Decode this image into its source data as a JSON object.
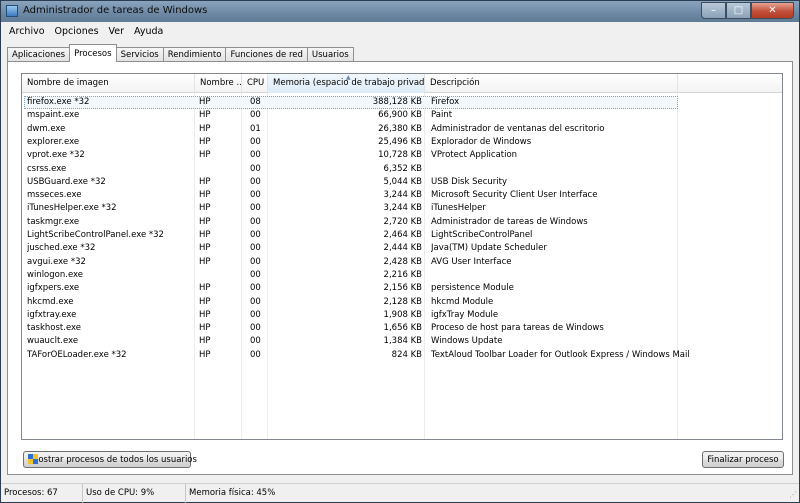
{
  "window": {
    "title": "Administrador de tareas de Windows",
    "caption_buttons": {
      "minimize": "–",
      "maximize": "□",
      "close": "✕"
    }
  },
  "menu": [
    "Archivo",
    "Opciones",
    "Ver",
    "Ayuda"
  ],
  "tabs": [
    {
      "label": "Aplicaciones",
      "active": false
    },
    {
      "label": "Procesos",
      "active": true
    },
    {
      "label": "Servicios",
      "active": false
    },
    {
      "label": "Rendimiento",
      "active": false
    },
    {
      "label": "Funciones de red",
      "active": false
    },
    {
      "label": "Usuarios",
      "active": false
    }
  ],
  "columns": {
    "name": "Nombre de imagen",
    "user": "Nombre ...",
    "cpu": "CPU",
    "mem": "Memoria (espacio de trabajo privado)",
    "desc": "Descripción"
  },
  "processes": [
    {
      "name": "firefox.exe *32",
      "user": "HP",
      "cpu": "08",
      "mem": "388,128 KB",
      "desc": "Firefox",
      "selected": true
    },
    {
      "name": "mspaint.exe",
      "user": "HP",
      "cpu": "00",
      "mem": "66,900 KB",
      "desc": "Paint"
    },
    {
      "name": "dwm.exe",
      "user": "HP",
      "cpu": "01",
      "mem": "26,380 KB",
      "desc": "Administrador de ventanas del escritorio"
    },
    {
      "name": "explorer.exe",
      "user": "HP",
      "cpu": "00",
      "mem": "25,496 KB",
      "desc": "Explorador de Windows"
    },
    {
      "name": "vprot.exe *32",
      "user": "HP",
      "cpu": "00",
      "mem": "10,728 KB",
      "desc": "VProtect Application"
    },
    {
      "name": "csrss.exe",
      "user": "",
      "cpu": "00",
      "mem": "6,352 KB",
      "desc": ""
    },
    {
      "name": "USBGuard.exe *32",
      "user": "HP",
      "cpu": "00",
      "mem": "5,044 KB",
      "desc": "USB Disk Security"
    },
    {
      "name": "msseces.exe",
      "user": "HP",
      "cpu": "00",
      "mem": "3,244 KB",
      "desc": "Microsoft Security Client User Interface"
    },
    {
      "name": "iTunesHelper.exe *32",
      "user": "HP",
      "cpu": "00",
      "mem": "3,244 KB",
      "desc": "iTunesHelper"
    },
    {
      "name": "taskmgr.exe",
      "user": "HP",
      "cpu": "00",
      "mem": "2,720 KB",
      "desc": "Administrador de tareas de Windows"
    },
    {
      "name": "LightScribeControlPanel.exe *32",
      "user": "HP",
      "cpu": "00",
      "mem": "2,464 KB",
      "desc": "LightScribeControlPanel"
    },
    {
      "name": "jusched.exe *32",
      "user": "HP",
      "cpu": "00",
      "mem": "2,444 KB",
      "desc": "Java(TM) Update Scheduler"
    },
    {
      "name": "avgui.exe *32",
      "user": "HP",
      "cpu": "00",
      "mem": "2,428 KB",
      "desc": "AVG User Interface"
    },
    {
      "name": "winlogon.exe",
      "user": "",
      "cpu": "00",
      "mem": "2,216 KB",
      "desc": ""
    },
    {
      "name": "igfxpers.exe",
      "user": "HP",
      "cpu": "00",
      "mem": "2,156 KB",
      "desc": "persistence Module"
    },
    {
      "name": "hkcmd.exe",
      "user": "HP",
      "cpu": "00",
      "mem": "2,128 KB",
      "desc": "hkcmd Module"
    },
    {
      "name": "igfxtray.exe",
      "user": "HP",
      "cpu": "00",
      "mem": "1,908 KB",
      "desc": "igfxTray Module"
    },
    {
      "name": "taskhost.exe",
      "user": "HP",
      "cpu": "00",
      "mem": "1,656 KB",
      "desc": "Proceso de host para tareas de Windows"
    },
    {
      "name": "wuauclt.exe",
      "user": "HP",
      "cpu": "00",
      "mem": "1,384 KB",
      "desc": "Windows Update"
    },
    {
      "name": "TAForOELoader.exe *32",
      "user": "HP",
      "cpu": "00",
      "mem": "824 KB",
      "desc": "TextAloud Toolbar Loader for Outlook Express / Windows Mail"
    }
  ],
  "buttons": {
    "show_all": "Mostrar procesos de todos los usuarios",
    "end_process": "Finalizar proceso"
  },
  "status": {
    "processes": "Procesos: 67",
    "cpu": "Uso de CPU: 9%",
    "memory": "Memoria física: 45%"
  },
  "colors": {
    "selection_border": "#7da2ce",
    "window_frame": "#c9d7e6",
    "close_button": "#c2503a"
  },
  "icons": [
    "window-app-icon",
    "uac-shield-icon",
    "sort-ascending-icon",
    "size-grip-icon"
  ]
}
